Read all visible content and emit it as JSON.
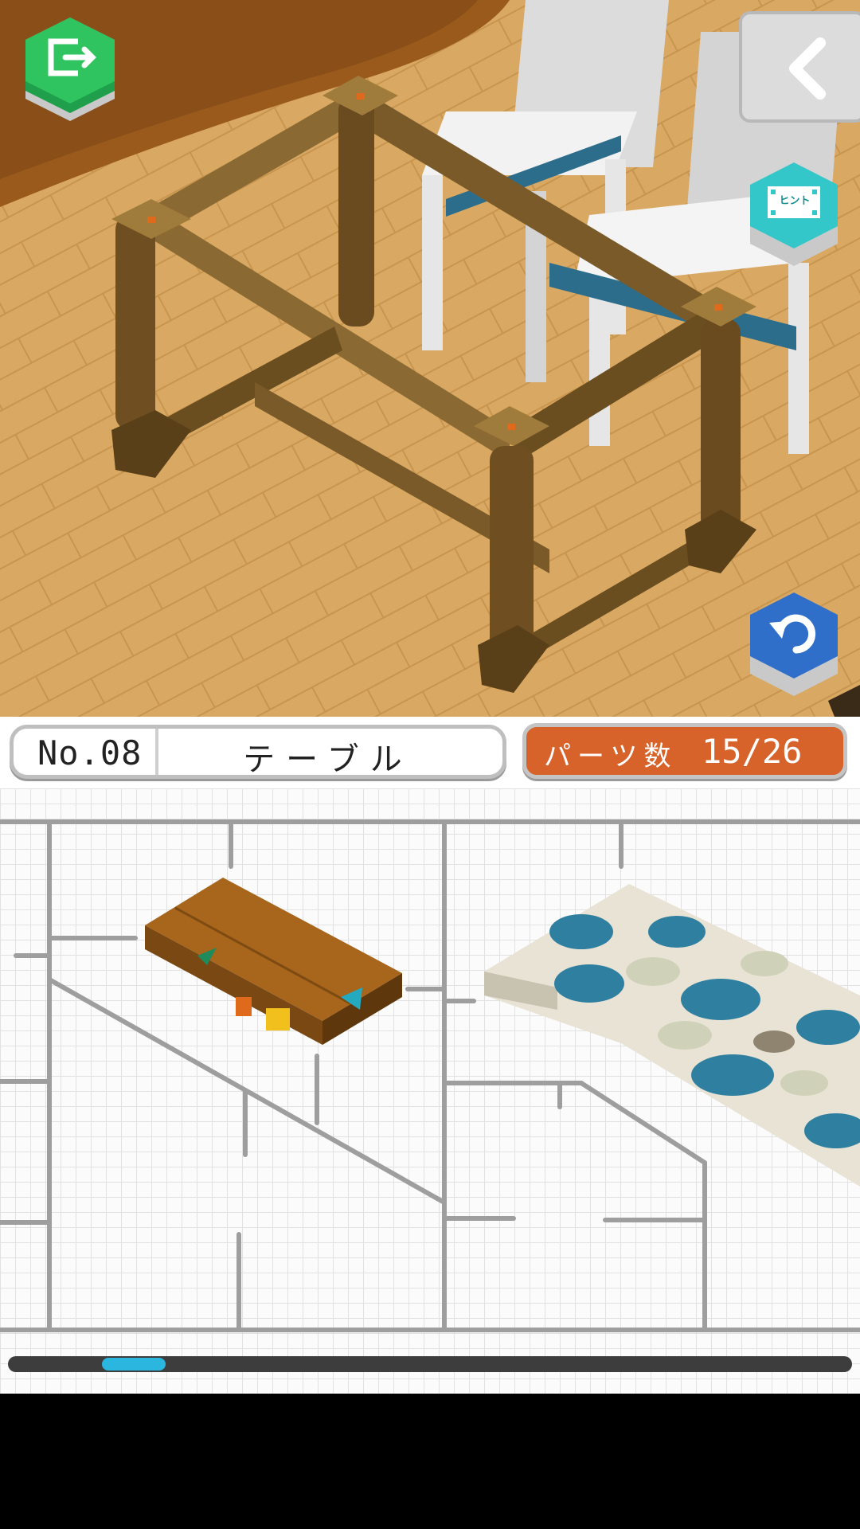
{
  "level": {
    "number_label": "No.08",
    "name": "テーブル"
  },
  "parts": {
    "label": "パーツ数",
    "count": "15/26",
    "placed": 15,
    "total": 26
  },
  "buttons": {
    "exit_icon": "exit-door-icon",
    "back_icon": "chevron-left-icon",
    "hint_label": "ヒント",
    "undo_icon": "undo-icon"
  },
  "tray": {
    "items": [
      "tabletop-plank-part",
      "leaf-pattern-tabletop-part"
    ],
    "scroll_position": 0.12
  },
  "colors": {
    "exit_button": "#2fc45f",
    "hint_button": "#34c7c9",
    "undo_button": "#2f6fc9",
    "parts_badge": "#d7622a",
    "scroll_thumb": "#2bb6e0"
  }
}
